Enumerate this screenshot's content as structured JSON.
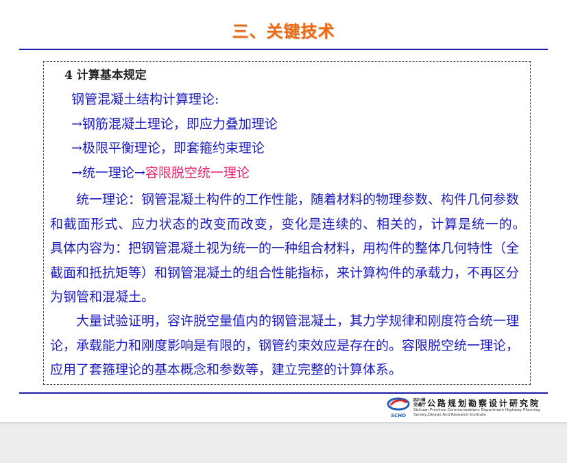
{
  "slide": {
    "title": "三、关键技术",
    "heading": "4 计算基本规定",
    "lines": [
      "钢管混凝土结构计算理论:",
      "→钢筋混凝土理论，即应力叠加理论",
      "→极限平衡理论，即套箍约束理论"
    ],
    "line4_prefix": "→统一理论→",
    "line4_highlight": "容限脱空统一理论",
    "paragraph1": "统一理论：钢管混凝土构件的工作性能，随着材料的物理参数、构件几何参数和截面形式、应力状态的改变而改变，变化是连续的、相关的，计算是统一的。　具体内容为：把钢管混凝土视为统一的一种组合材料，用构件的整体几何特性（全截面和抵抗矩等）和钢管混凝土的组合性能指标，来计算构件的承载力，不再区分为钢管和混凝土。",
    "paragraph2": "大量试验证明，容许脱空量值内的钢管混凝土，其力学规律和刚度符合统一理论，承载能力和刚度影响是有限的，钢管约束效应是存在的。容限脱空统一理论，应用了套箍理论的基本概念和参数等，建立完整的计算体系。"
  },
  "logo": {
    "icon": "schd-logo-icon",
    "abbr": "SCHD",
    "province_label": "四川省交通厅",
    "name": "公路规划勘察设计研究院",
    "english_line1": "Sichuan Province Communications Department Highway Planning,",
    "english_line2": "Survey,Design And Research Institute"
  },
  "colors": {
    "title": "#ee6a10",
    "body_text": "#1b1bc0",
    "highlight": "#e8226a",
    "rule": "#1a1aa8"
  }
}
